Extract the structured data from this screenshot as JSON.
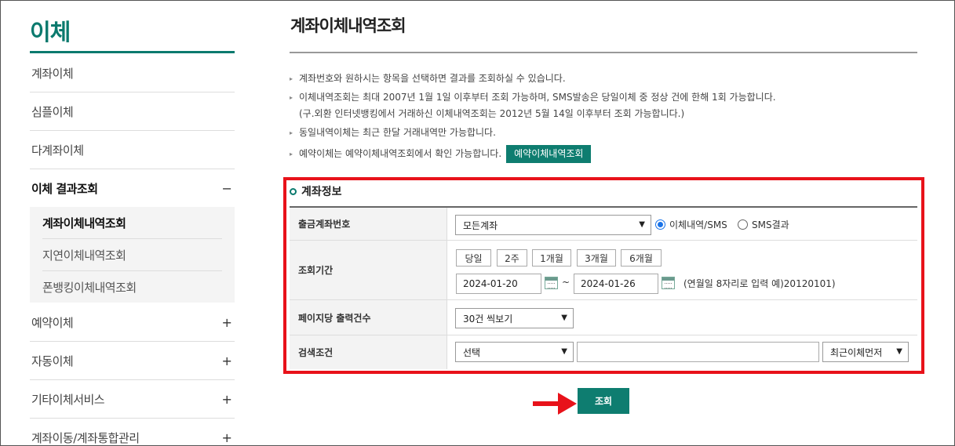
{
  "sidebar": {
    "title": "이체",
    "items": [
      {
        "label": "계좌이체",
        "sign": ""
      },
      {
        "label": "심플이체",
        "sign": ""
      },
      {
        "label": "다계좌이체",
        "sign": ""
      },
      {
        "label": "이체 결과조회",
        "sign": "−"
      },
      {
        "label": "예약이체",
        "sign": "+"
      },
      {
        "label": "자동이체",
        "sign": "+"
      },
      {
        "label": "기타이체서비스",
        "sign": "+"
      },
      {
        "label": "계좌이동/계좌통합관리",
        "sign": "+"
      }
    ],
    "sub_items": [
      {
        "label": "계좌이체내역조회"
      },
      {
        "label": "지연이체내역조회"
      },
      {
        "label": "폰뱅킹이체내역조회"
      }
    ]
  },
  "main": {
    "title": "계좌이체내역조회",
    "notes": [
      "계좌번호와 원하시는 항목을 선택하면 결과를 조회하실 수 있습니다.",
      "이체내역조회는 최대 2007년 1월 1일 이후부터 조회 가능하며, SMS발송은 당일이체 중 정상 건에 한해 1회 가능합니다.",
      "(구.외환 인터넷뱅킹에서 거래하신 이체내역조회는 2012년 5월 14일 이후부터 조회 가능합니다.)",
      "동일내역이체는 최근 한달 거래내역만 가능합니다.",
      "예약이체는 예약이체내역조회에서 확인 가능합니다."
    ],
    "reserved_button": "예약이체내역조회",
    "section_title": "계좌정보",
    "form": {
      "account": {
        "label": "출금계좌번호",
        "selected": "모든계좌",
        "radio_options": [
          {
            "label": "이체내역/SMS",
            "checked": true
          },
          {
            "label": "SMS결과",
            "checked": false
          }
        ]
      },
      "period": {
        "label": "조회기간",
        "buttons": [
          "당일",
          "2주",
          "1개월",
          "3개월",
          "6개월"
        ],
        "start_date": "2024-01-20",
        "separator": "~",
        "end_date": "2024-01-26",
        "hint": "(연월일 8자리로 입력 예)20120101)"
      },
      "per_page": {
        "label": "페이지당 출력건수",
        "selected": "30건 씩보기"
      },
      "search": {
        "label": "검색조건",
        "condition_selected": "선택",
        "keyword_value": "",
        "sort_selected": "최근이체먼저"
      }
    },
    "submit_button": "조회"
  },
  "colors": {
    "brand": "#0a7a6e",
    "button": "#0e7d70",
    "highlight": "#e8121a"
  }
}
